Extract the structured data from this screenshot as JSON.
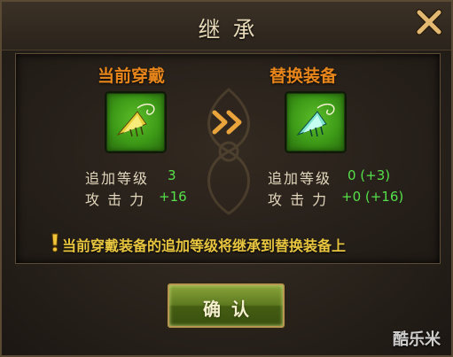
{
  "dialog": {
    "title": "继承",
    "close_icon": "close-icon"
  },
  "left": {
    "title": "当前穿戴",
    "item_icon": "green-wing-fan-icon",
    "stats": [
      {
        "label": "追加等级",
        "value": "3"
      },
      {
        "label": "攻 击 力",
        "value": "+16"
      }
    ]
  },
  "arrow_icon": "double-chevron-right-icon",
  "right": {
    "title": "替换装备",
    "item_icon": "cyan-wing-fan-icon",
    "stats": [
      {
        "label": "追加等级",
        "value": "0 (+3)"
      },
      {
        "label": "攻 击 力",
        "value": "+0 (+16)"
      }
    ]
  },
  "notice": {
    "text": "当前穿戴装备的追加等级将继承到替换装备上",
    "icon": "exclamation-icon"
  },
  "confirm": {
    "label": "确认"
  },
  "watermark": "酷乐米",
  "colors": {
    "title_orange": "#e8861c",
    "stat_green": "#55e04a",
    "notice_yellow": "#e9c63f",
    "slot_green": "#3d9a17",
    "button_green": "#5e7a20"
  }
}
